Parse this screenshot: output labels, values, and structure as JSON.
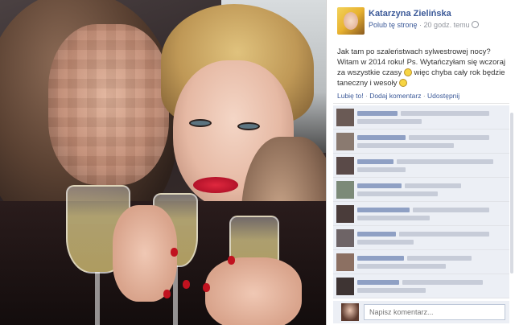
{
  "post": {
    "page_name": "Katarzyna Zielińska",
    "like_page": "Polub tę stronę",
    "separator": " · ",
    "time": "20 godz. temu",
    "text": "Jak tam po szaleństwach sylwestrowej nocy? Witam w 2014 roku! Ps. Wytańczyłam się wczoraj za wszystkie czasy",
    "text_cont": " więc chyba cały rok będzie taneczny i wesoły",
    "actions": {
      "like": "Lubię to!",
      "comment": "Dodaj komentarz",
      "share": "Udostępnij",
      "sep": " · "
    },
    "comment_placeholder": "Napisz komentarz..."
  },
  "icons": [
    "globe-icon",
    "smiley-icon"
  ],
  "colors": {
    "link": "#3b5998",
    "muted": "#90949c",
    "comment_bg": "#eceff5",
    "lips": "#c1121f"
  }
}
